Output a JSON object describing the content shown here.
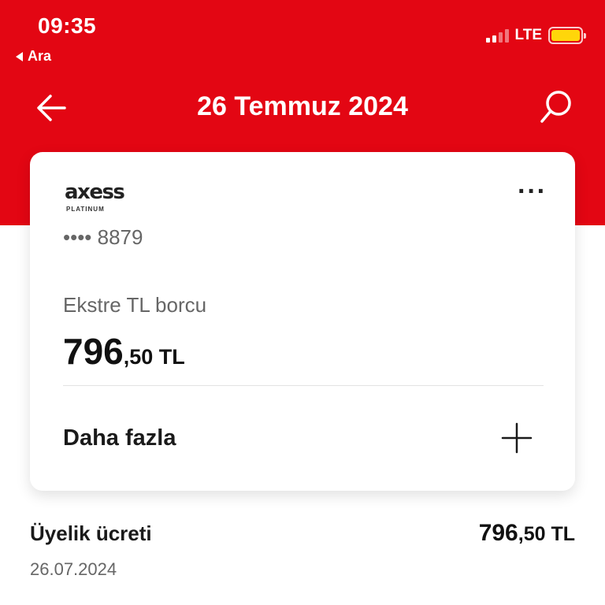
{
  "status_bar": {
    "time": "09:35",
    "back_label": "Ara",
    "network": "LTE"
  },
  "header": {
    "title": "26 Temmuz 2024",
    "back_icon": "arrow-left-icon",
    "search_icon": "search-icon"
  },
  "card": {
    "brand": "axess",
    "brand_tier": "PLATINUM",
    "masked_number": "•••• 8879",
    "statement_label": "Ekstre TL borcu",
    "amount_integer": "796",
    "amount_fraction": ",50 TL",
    "more_label": "Daha fazla"
  },
  "transaction": {
    "title": "Üyelik ücreti",
    "date": "26.07.2024",
    "amount_integer": "796",
    "amount_fraction": ",50 TL"
  },
  "colors": {
    "brand_red": "#e30613",
    "battery": "#ffd60a"
  }
}
